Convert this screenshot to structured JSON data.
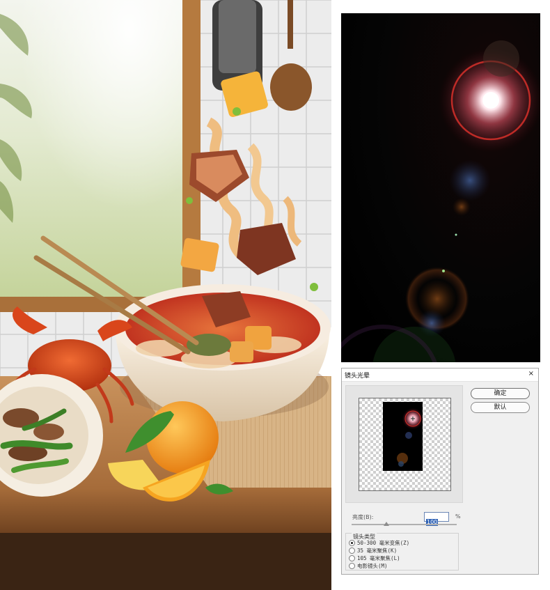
{
  "dialog": {
    "title": "镜头光晕",
    "close_glyph": "×",
    "ok_label": "确定",
    "default_label": "默认",
    "brightness": {
      "label": "亮度(B):",
      "value": "100",
      "unit": "%",
      "level_fraction": 0.33
    },
    "lens_type": {
      "title": "镜头类型",
      "options": [
        {
          "label": "50-300 毫米变焦(Z)",
          "checked": true
        },
        {
          "label": "35 毫米聚焦(K)",
          "checked": false
        },
        {
          "label": "105 毫米聚焦(L)",
          "checked": false
        },
        {
          "label": "电影镜头(M)",
          "checked": false
        }
      ]
    }
  },
  "colors": {
    "flare_core": "#ffffff",
    "flare_ring": "#d7302a",
    "flare_background": "#000000",
    "selection_highlight": "#2f62b5"
  }
}
